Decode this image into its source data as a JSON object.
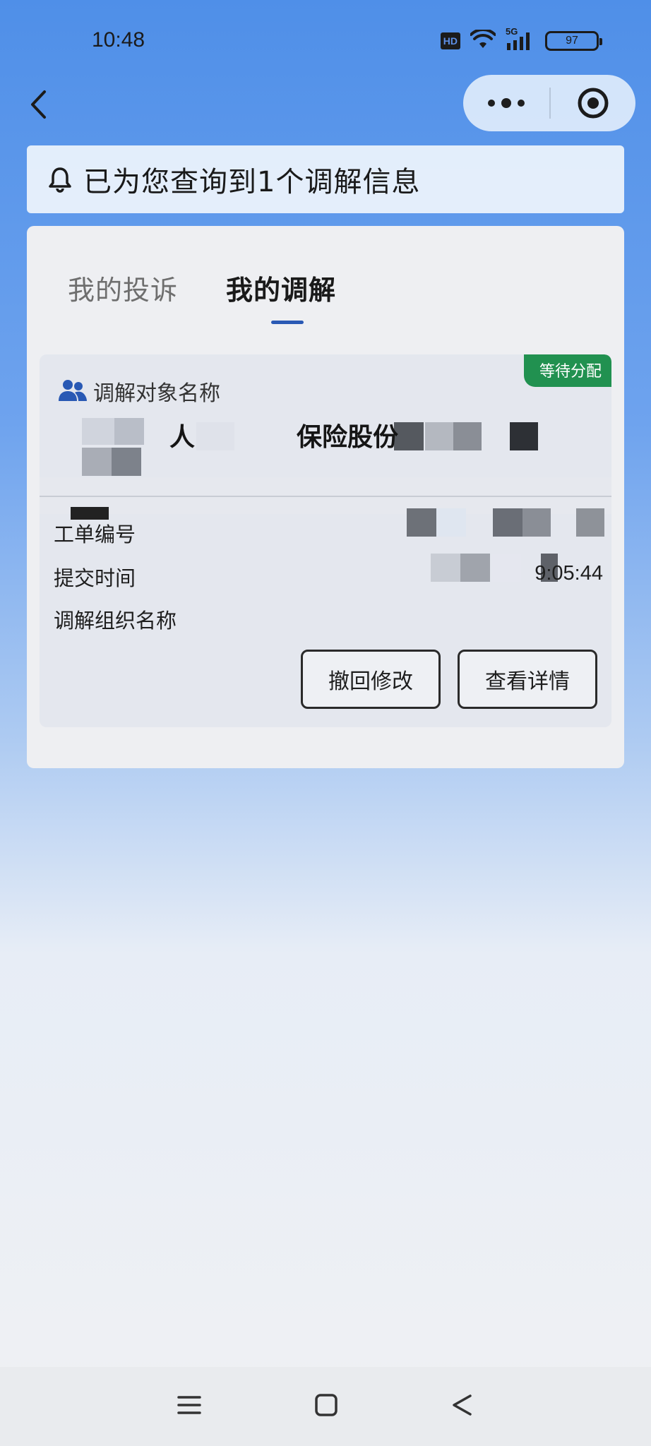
{
  "status_bar": {
    "time": "10:48",
    "hd_label": "HD",
    "network_label": "5G",
    "battery_level": "97"
  },
  "header": {
    "back_icon": "chevron-left-icon",
    "more_icon": "more-dots-icon",
    "close_icon": "target-circle-icon"
  },
  "notice": {
    "icon": "bell-icon",
    "text": "已为您查询到1个调解信息"
  },
  "tabs": [
    {
      "label": "我的投诉",
      "active": false
    },
    {
      "label": "我的调解",
      "active": true
    }
  ],
  "record": {
    "status_badge": "等待分配",
    "target_label": "调解对象名称",
    "target_name_visible_fragments": [
      "人",
      "保险股份"
    ],
    "fields": {
      "ticket_label": "工单编号",
      "submit_time_label": "提交时间",
      "submit_time_value_fragment": "9:05:44",
      "org_label": "调解组织名称"
    },
    "buttons": {
      "withdraw_label": "撤回修改",
      "details_label": "查看详情"
    }
  },
  "colors": {
    "accent_blue": "#2959b4",
    "badge_green": "#219150",
    "background_top": "#4f8fe8"
  }
}
